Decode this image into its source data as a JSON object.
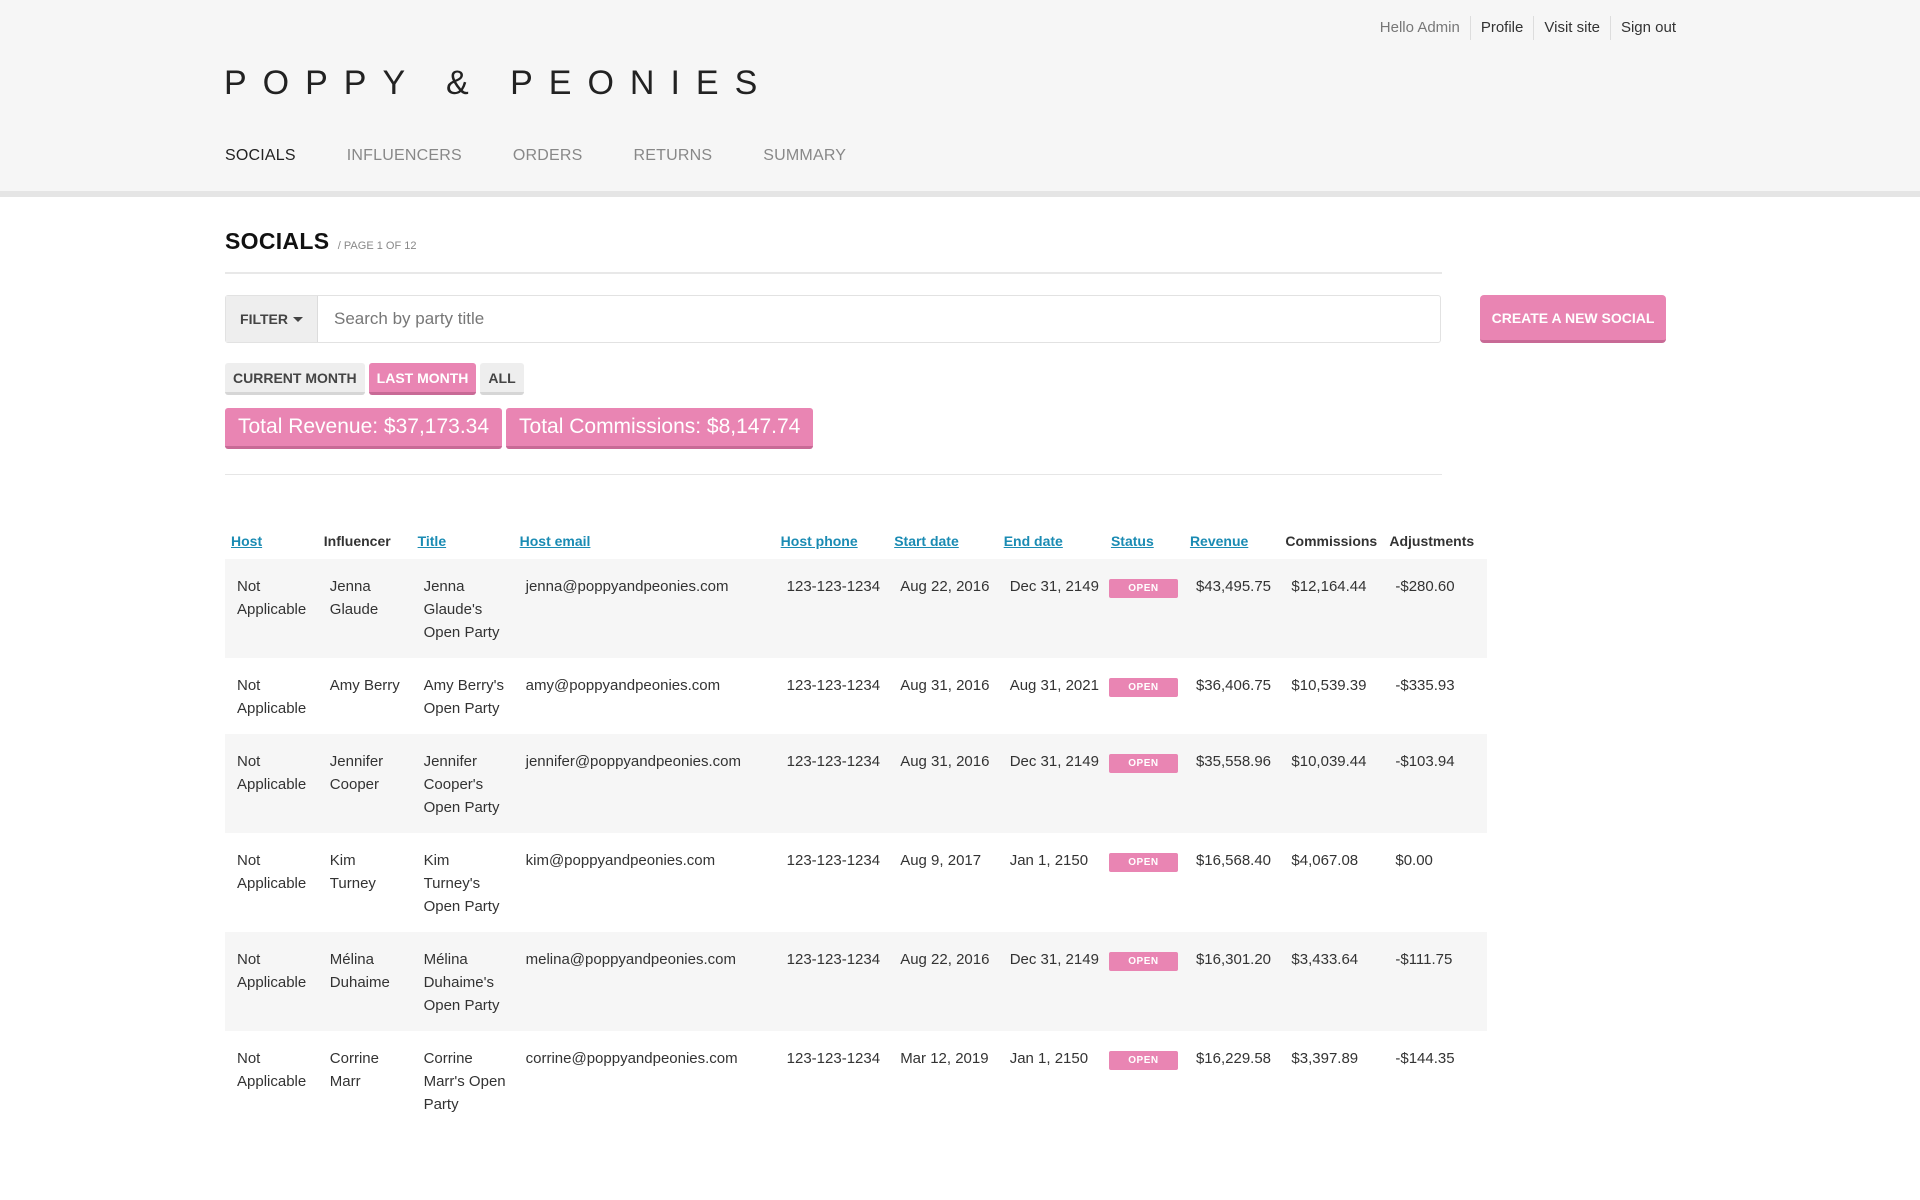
{
  "user_nav": {
    "greeting": "Hello Admin",
    "profile": "Profile",
    "visit_site": "Visit site",
    "sign_out": "Sign out"
  },
  "brand": {
    "logo": "POPPY & PEONIES"
  },
  "main_nav": {
    "items": [
      {
        "label": "SOCIALS",
        "active": true
      },
      {
        "label": "INFLUENCERS",
        "active": false
      },
      {
        "label": "ORDERS",
        "active": false
      },
      {
        "label": "RETURNS",
        "active": false
      },
      {
        "label": "SUMMARY",
        "active": false
      }
    ]
  },
  "page": {
    "title": "SOCIALS",
    "subtitle": "/ PAGE 1 OF 12"
  },
  "filter": {
    "label": "FILTER",
    "placeholder": "Search by party title",
    "value": ""
  },
  "create_button": "CREATE A NEW SOCIAL",
  "period_toggles": {
    "current_month": "CURRENT MONTH",
    "last_month": "LAST MONTH",
    "all": "ALL",
    "selected": "LAST MONTH"
  },
  "totals": {
    "revenue": "Total Revenue: $37,173.34",
    "commissions": "Total Commissions: $8,147.74"
  },
  "table": {
    "columns": {
      "host": "Host",
      "influencer": "Influencer",
      "title": "Title",
      "host_email": "Host email",
      "host_phone": "Host phone",
      "start_date": "Start date",
      "end_date": "End date",
      "status": "Status",
      "revenue": "Revenue",
      "commissions": "Commissions",
      "adjustments": "Adjustments"
    },
    "rows": [
      {
        "host": "Not Applicable",
        "influencer": "Jenna Glaude",
        "title": "Jenna Glaude's Open Party",
        "email": "jenna@poppyandpeonies.com",
        "phone": "123-123-1234",
        "start": "Aug 22, 2016",
        "end": "Dec 31, 2149",
        "status": "OPEN",
        "revenue": "$43,495.75",
        "commissions": "$12,164.44",
        "adjustments": "-$280.60"
      },
      {
        "host": "Not Applicable",
        "influencer": "Amy Berry",
        "title": "Amy Berry's Open Party",
        "email": "amy@poppyandpeonies.com",
        "phone": "123-123-1234",
        "start": "Aug 31, 2016",
        "end": "Aug 31, 2021",
        "status": "OPEN",
        "revenue": "$36,406.75",
        "commissions": "$10,539.39",
        "adjustments": "-$335.93"
      },
      {
        "host": "Not Applicable",
        "influencer": "Jennifer Cooper",
        "title": "Jennifer Cooper's Open Party",
        "email": "jennifer@poppyandpeonies.com",
        "phone": "123-123-1234",
        "start": "Aug 31, 2016",
        "end": "Dec 31, 2149",
        "status": "OPEN",
        "revenue": "$35,558.96",
        "commissions": "$10,039.44",
        "adjustments": "-$103.94"
      },
      {
        "host": "Not Applicable",
        "influencer": "Kim Turney",
        "title": "Kim Turney's Open Party",
        "email": "kim@poppyandpeonies.com",
        "phone": "123-123-1234",
        "start": "Aug 9, 2017",
        "end": "Jan 1, 2150",
        "status": "OPEN",
        "revenue": "$16,568.40",
        "commissions": "$4,067.08",
        "adjustments": "$0.00"
      },
      {
        "host": "Not Applicable",
        "influencer": "Mélina Duhaime",
        "title": "Mélina Duhaime's Open Party",
        "email": "melina@poppyandpeonies.com",
        "phone": "123-123-1234",
        "start": "Aug 22, 2016",
        "end": "Dec 31, 2149",
        "status": "OPEN",
        "revenue": "$16,301.20",
        "commissions": "$3,433.64",
        "adjustments": "-$111.75"
      },
      {
        "host": "Not Applicable",
        "influencer": "Corrine Marr",
        "title": "Corrine Marr's Open Party",
        "email": "corrine@poppyandpeonies.com",
        "phone": "123-123-1234",
        "start": "Mar 12, 2019",
        "end": "Jan 1, 2150",
        "status": "OPEN",
        "revenue": "$16,229.58",
        "commissions": "$3,397.89",
        "adjustments": "-$144.35"
      }
    ]
  },
  "colors": {
    "accent_pink": "#e985b3",
    "link_blue": "#1a8bb3",
    "header_bg": "#f6f6f6"
  }
}
